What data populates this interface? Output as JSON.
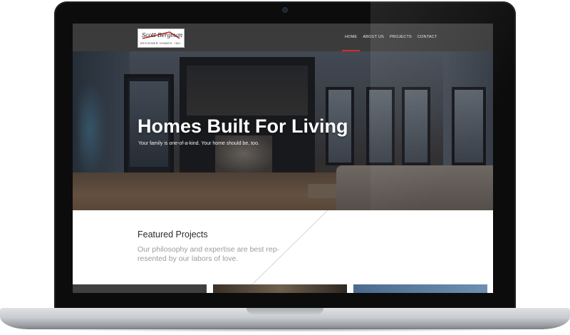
{
  "site": {
    "logo": {
      "signature": "Scott Bergman",
      "subtitle": "DESIGNER HOMES, INC.",
      "roof_color": "#cc2a2a"
    },
    "nav": {
      "items": [
        {
          "label": "HOME",
          "active": true
        },
        {
          "label": "ABOUT US",
          "active": false
        },
        {
          "label": "PROJECTS",
          "active": false
        },
        {
          "label": "CONTACT",
          "active": false
        }
      ],
      "active_color": "#d22c2c",
      "background": "#3b3b3b"
    },
    "hero": {
      "title": "Homes Built For Living",
      "subtitle": "Your family is one-of-a-kind. Your home should be, too."
    },
    "featured": {
      "title": "Featured Projects",
      "text": "Our philosophy and expertise are best rep-resented by our labors of love."
    }
  }
}
